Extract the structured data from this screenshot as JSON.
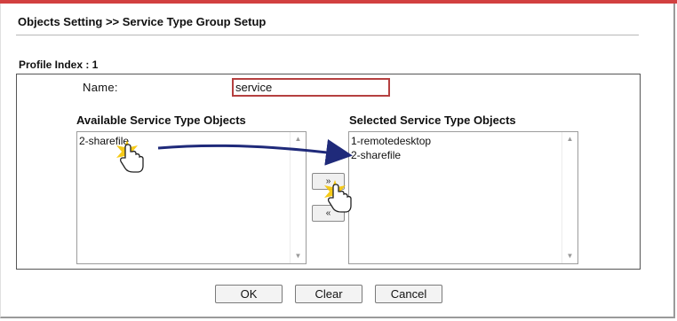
{
  "header": {
    "title": "Objects Setting >> Service Type Group Setup"
  },
  "profile": {
    "index_label": "Profile Index : 1",
    "name_label": "Name:",
    "name_value": "service"
  },
  "available": {
    "label": "Available Service Type Objects",
    "items": [
      "2-sharefile"
    ]
  },
  "selected": {
    "label": "Selected Service Type Objects",
    "items": [
      "1-remotedesktop",
      "2-sharefile"
    ]
  },
  "move_buttons": {
    "add": "»",
    "remove": "«"
  },
  "actions": {
    "ok": "OK",
    "clear": "Clear",
    "cancel": "Cancel"
  },
  "icons": {
    "pointer": "hand-pointer-icon",
    "arrow": "drag-arrow"
  },
  "colors": {
    "accent_border": "#b54040",
    "arrow": "#1f2a7a",
    "highlight": "#f5c400"
  }
}
